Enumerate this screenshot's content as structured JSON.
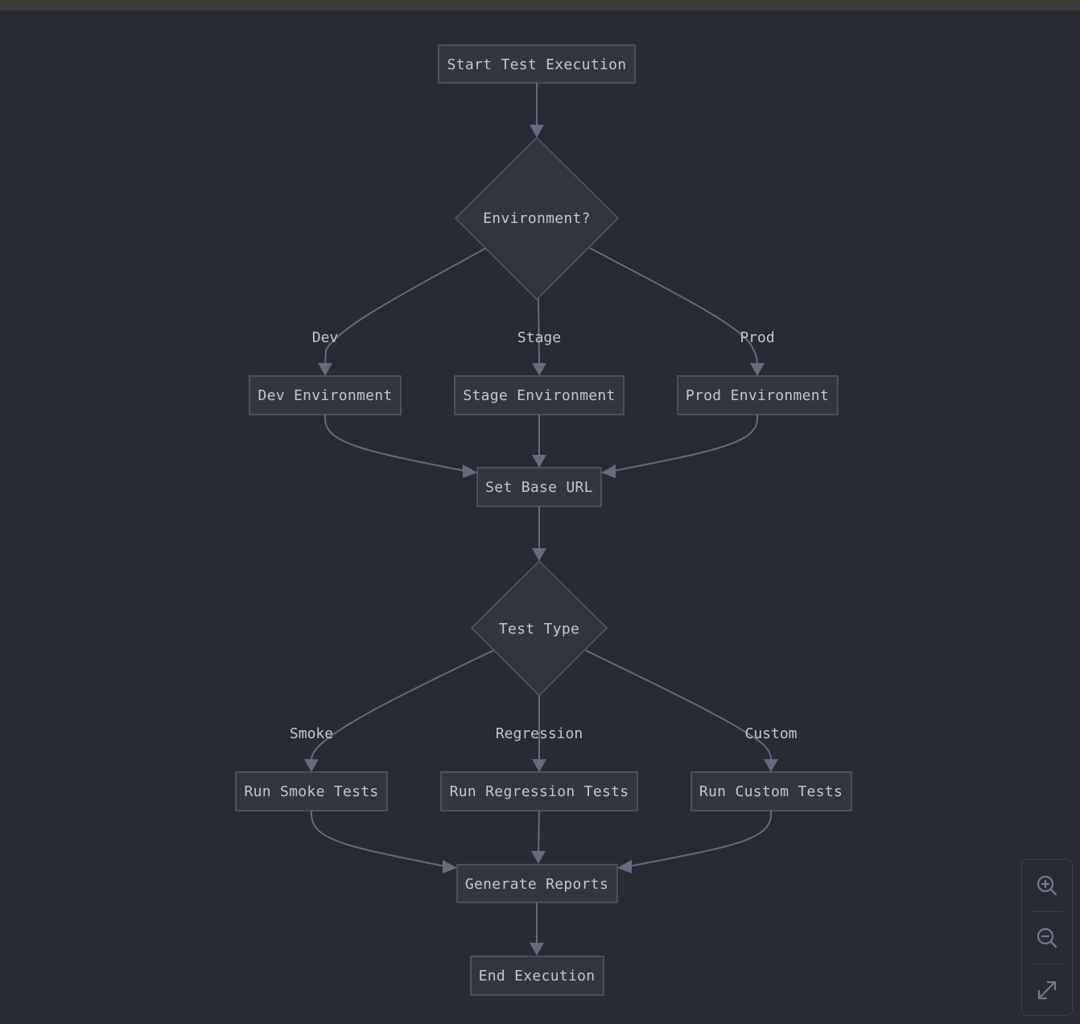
{
  "diagram": {
    "type": "flowchart",
    "nodes": [
      {
        "id": "start",
        "label": "Start Test Execution",
        "shape": "rect"
      },
      {
        "id": "env",
        "label": "Environment?",
        "shape": "diamond"
      },
      {
        "id": "dev",
        "label": "Dev Environment",
        "shape": "rect"
      },
      {
        "id": "stage",
        "label": "Stage Environment",
        "shape": "rect"
      },
      {
        "id": "prod",
        "label": "Prod Environment",
        "shape": "rect"
      },
      {
        "id": "base",
        "label": "Set Base URL",
        "shape": "rect"
      },
      {
        "id": "ttype",
        "label": "Test Type",
        "shape": "diamond"
      },
      {
        "id": "smoke",
        "label": "Run Smoke Tests",
        "shape": "rect"
      },
      {
        "id": "regr",
        "label": "Run Regression Tests",
        "shape": "rect"
      },
      {
        "id": "custom",
        "label": "Run Custom Tests",
        "shape": "rect"
      },
      {
        "id": "reports",
        "label": "Generate Reports",
        "shape": "rect"
      },
      {
        "id": "end",
        "label": "End Execution",
        "shape": "rect"
      }
    ],
    "edges": [
      {
        "from": "start",
        "to": "env",
        "label": ""
      },
      {
        "from": "env",
        "to": "dev",
        "label": "Dev"
      },
      {
        "from": "env",
        "to": "stage",
        "label": "Stage"
      },
      {
        "from": "env",
        "to": "prod",
        "label": "Prod"
      },
      {
        "from": "dev",
        "to": "base",
        "label": ""
      },
      {
        "from": "stage",
        "to": "base",
        "label": ""
      },
      {
        "from": "prod",
        "to": "base",
        "label": ""
      },
      {
        "from": "base",
        "to": "ttype",
        "label": ""
      },
      {
        "from": "ttype",
        "to": "smoke",
        "label": "Smoke"
      },
      {
        "from": "ttype",
        "to": "regr",
        "label": "Regression"
      },
      {
        "from": "ttype",
        "to": "custom",
        "label": "Custom"
      },
      {
        "from": "smoke",
        "to": "reports",
        "label": ""
      },
      {
        "from": "regr",
        "to": "reports",
        "label": ""
      },
      {
        "from": "custom",
        "to": "reports",
        "label": ""
      },
      {
        "from": "reports",
        "to": "end",
        "label": ""
      }
    ]
  },
  "controls": {
    "zoom_in": "zoom-in-icon",
    "zoom_out": "zoom-out-icon",
    "fit": "expand-icon"
  },
  "colors": {
    "background": "#282b34",
    "node_fill": "#33363f",
    "node_stroke": "#5f6676",
    "edge": "#646c7e",
    "text": "#c3c7d0"
  }
}
